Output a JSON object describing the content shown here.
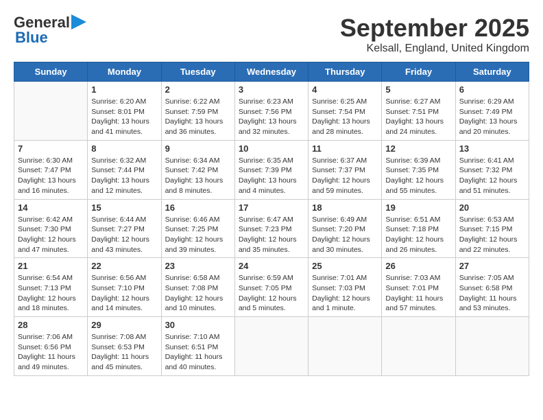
{
  "header": {
    "logo_general": "General",
    "logo_blue": "Blue",
    "month": "September 2025",
    "location": "Kelsall, England, United Kingdom"
  },
  "weekdays": [
    "Sunday",
    "Monday",
    "Tuesday",
    "Wednesday",
    "Thursday",
    "Friday",
    "Saturday"
  ],
  "weeks": [
    [
      {
        "day": "",
        "info": ""
      },
      {
        "day": "1",
        "info": "Sunrise: 6:20 AM\nSunset: 8:01 PM\nDaylight: 13 hours\nand 41 minutes."
      },
      {
        "day": "2",
        "info": "Sunrise: 6:22 AM\nSunset: 7:59 PM\nDaylight: 13 hours\nand 36 minutes."
      },
      {
        "day": "3",
        "info": "Sunrise: 6:23 AM\nSunset: 7:56 PM\nDaylight: 13 hours\nand 32 minutes."
      },
      {
        "day": "4",
        "info": "Sunrise: 6:25 AM\nSunset: 7:54 PM\nDaylight: 13 hours\nand 28 minutes."
      },
      {
        "day": "5",
        "info": "Sunrise: 6:27 AM\nSunset: 7:51 PM\nDaylight: 13 hours\nand 24 minutes."
      },
      {
        "day": "6",
        "info": "Sunrise: 6:29 AM\nSunset: 7:49 PM\nDaylight: 13 hours\nand 20 minutes."
      }
    ],
    [
      {
        "day": "7",
        "info": "Sunrise: 6:30 AM\nSunset: 7:47 PM\nDaylight: 13 hours\nand 16 minutes."
      },
      {
        "day": "8",
        "info": "Sunrise: 6:32 AM\nSunset: 7:44 PM\nDaylight: 13 hours\nand 12 minutes."
      },
      {
        "day": "9",
        "info": "Sunrise: 6:34 AM\nSunset: 7:42 PM\nDaylight: 13 hours\nand 8 minutes."
      },
      {
        "day": "10",
        "info": "Sunrise: 6:35 AM\nSunset: 7:39 PM\nDaylight: 13 hours\nand 4 minutes."
      },
      {
        "day": "11",
        "info": "Sunrise: 6:37 AM\nSunset: 7:37 PM\nDaylight: 12 hours\nand 59 minutes."
      },
      {
        "day": "12",
        "info": "Sunrise: 6:39 AM\nSunset: 7:35 PM\nDaylight: 12 hours\nand 55 minutes."
      },
      {
        "day": "13",
        "info": "Sunrise: 6:41 AM\nSunset: 7:32 PM\nDaylight: 12 hours\nand 51 minutes."
      }
    ],
    [
      {
        "day": "14",
        "info": "Sunrise: 6:42 AM\nSunset: 7:30 PM\nDaylight: 12 hours\nand 47 minutes."
      },
      {
        "day": "15",
        "info": "Sunrise: 6:44 AM\nSunset: 7:27 PM\nDaylight: 12 hours\nand 43 minutes."
      },
      {
        "day": "16",
        "info": "Sunrise: 6:46 AM\nSunset: 7:25 PM\nDaylight: 12 hours\nand 39 minutes."
      },
      {
        "day": "17",
        "info": "Sunrise: 6:47 AM\nSunset: 7:23 PM\nDaylight: 12 hours\nand 35 minutes."
      },
      {
        "day": "18",
        "info": "Sunrise: 6:49 AM\nSunset: 7:20 PM\nDaylight: 12 hours\nand 30 minutes."
      },
      {
        "day": "19",
        "info": "Sunrise: 6:51 AM\nSunset: 7:18 PM\nDaylight: 12 hours\nand 26 minutes."
      },
      {
        "day": "20",
        "info": "Sunrise: 6:53 AM\nSunset: 7:15 PM\nDaylight: 12 hours\nand 22 minutes."
      }
    ],
    [
      {
        "day": "21",
        "info": "Sunrise: 6:54 AM\nSunset: 7:13 PM\nDaylight: 12 hours\nand 18 minutes."
      },
      {
        "day": "22",
        "info": "Sunrise: 6:56 AM\nSunset: 7:10 PM\nDaylight: 12 hours\nand 14 minutes."
      },
      {
        "day": "23",
        "info": "Sunrise: 6:58 AM\nSunset: 7:08 PM\nDaylight: 12 hours\nand 10 minutes."
      },
      {
        "day": "24",
        "info": "Sunrise: 6:59 AM\nSunset: 7:05 PM\nDaylight: 12 hours\nand 5 minutes."
      },
      {
        "day": "25",
        "info": "Sunrise: 7:01 AM\nSunset: 7:03 PM\nDaylight: 12 hours\nand 1 minute."
      },
      {
        "day": "26",
        "info": "Sunrise: 7:03 AM\nSunset: 7:01 PM\nDaylight: 11 hours\nand 57 minutes."
      },
      {
        "day": "27",
        "info": "Sunrise: 7:05 AM\nSunset: 6:58 PM\nDaylight: 11 hours\nand 53 minutes."
      }
    ],
    [
      {
        "day": "28",
        "info": "Sunrise: 7:06 AM\nSunset: 6:56 PM\nDaylight: 11 hours\nand 49 minutes."
      },
      {
        "day": "29",
        "info": "Sunrise: 7:08 AM\nSunset: 6:53 PM\nDaylight: 11 hours\nand 45 minutes."
      },
      {
        "day": "30",
        "info": "Sunrise: 7:10 AM\nSunset: 6:51 PM\nDaylight: 11 hours\nand 40 minutes."
      },
      {
        "day": "",
        "info": ""
      },
      {
        "day": "",
        "info": ""
      },
      {
        "day": "",
        "info": ""
      },
      {
        "day": "",
        "info": ""
      }
    ]
  ]
}
